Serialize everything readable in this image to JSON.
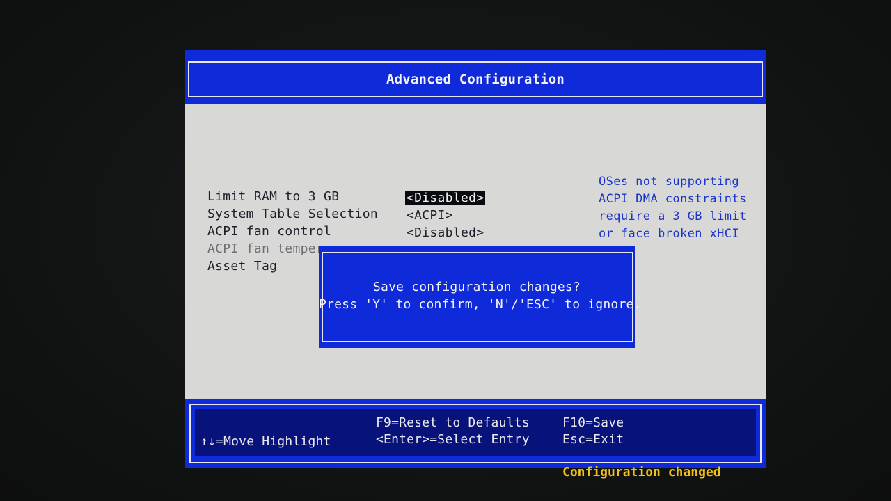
{
  "window": {
    "title": "Advanced Configuration"
  },
  "settings": [
    {
      "label": "Limit RAM to 3 GB",
      "value": "<Disabled>",
      "selected": true
    },
    {
      "label": "System Table Selection",
      "value": "<ACPI>"
    },
    {
      "label": "ACPI fan control",
      "value": "<Disabled>"
    },
    {
      "label": "ACPI fan temper"
    },
    {
      "label": "Asset Tag"
    }
  ],
  "help": {
    "lines": [
      "OSes not supporting",
      "ACPI DMA constraints",
      "require a 3 GB limit",
      "or face broken xHCI"
    ]
  },
  "dialog": {
    "line1": "Save configuration changes?",
    "line2": "Press 'Y' to confirm, 'N'/'ESC' to ignore."
  },
  "footer": {
    "move": "↑↓=Move Highlight",
    "reset": "F9=Reset to Defaults",
    "select": "<Enter>=Select Entry",
    "save": "F10=Save",
    "exit": "Esc=Exit"
  },
  "status": {
    "text": "Configuration changed"
  },
  "colors": {
    "bios_blue": "#0f2ad8",
    "panel_gray": "#d8d9d6",
    "help_text_blue": "#1c34c8",
    "status_yellow": "#f2c21a"
  }
}
